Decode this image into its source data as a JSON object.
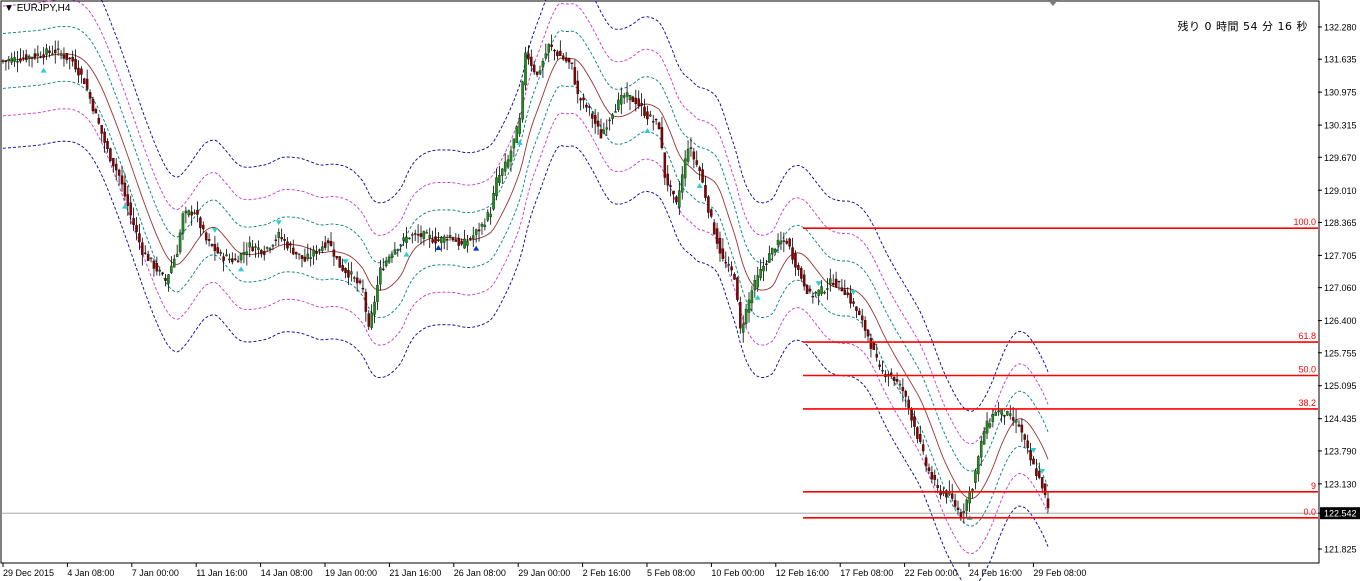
{
  "window": {
    "title_arrow": "▼",
    "title": "EURJPY,H4",
    "countdown": "残り 0 時間 54 分 16 秒"
  },
  "colors": {
    "bull": "#1a8f1a",
    "bear": "#8b0000",
    "wick": "#000000",
    "middle": "#993333",
    "band1": "#008080",
    "band2": "#cc33cc",
    "band3": "#000099",
    "fib": "#ff0000",
    "arrow_cyan": "#33cccc",
    "arrow_blue": "#0033cc",
    "price_tag_bg": "#000000"
  },
  "chart_data": {
    "type": "candlestick",
    "symbol": "EURJPY",
    "timeframe": "H4",
    "ylim": [
      121.825,
      132.6
    ],
    "y_ticks": [
      "132.280",
      "131.635",
      "130.975",
      "130.315",
      "129.670",
      "129.010",
      "128.365",
      "127.705",
      "127.060",
      "126.400",
      "125.755",
      "125.095",
      "124.435",
      "123.790",
      "123.130",
      "122.542",
      "121.825"
    ],
    "x_ticks": [
      "29 Dec 2015",
      "4 Jan 08:00",
      "7 Jan 00:00",
      "11 Jan 16:00",
      "14 Jan 08:00",
      "19 Jan 00:00",
      "21 Jan 16:00",
      "26 Jan 08:00",
      "29 Jan 00:00",
      "2 Feb 16:00",
      "5 Feb 08:00",
      "10 Feb 00:00",
      "12 Feb 16:00",
      "17 Feb 08:00",
      "22 Feb 00:00",
      "24 Feb 16:00",
      "29 Feb 08:00"
    ],
    "current_price": "122.542",
    "close_path": [
      [
        0,
        131.6
      ],
      [
        10,
        131.7
      ],
      [
        18,
        131.8
      ],
      [
        24,
        131.6
      ],
      [
        28,
        131.2
      ],
      [
        32,
        130.5
      ],
      [
        36,
        129.8
      ],
      [
        40,
        129.3
      ],
      [
        44,
        128.5
      ],
      [
        48,
        127.8
      ],
      [
        52,
        127.5
      ],
      [
        56,
        127.2
      ],
      [
        60,
        127.8
      ],
      [
        62,
        128.5
      ],
      [
        66,
        128.6
      ],
      [
        70,
        128.0
      ],
      [
        75,
        127.7
      ],
      [
        80,
        127.6
      ],
      [
        85,
        127.9
      ],
      [
        90,
        127.8
      ],
      [
        95,
        128.1
      ],
      [
        100,
        127.8
      ],
      [
        104,
        127.6
      ],
      [
        108,
        127.8
      ],
      [
        112,
        128.0
      ],
      [
        116,
        127.5
      ],
      [
        120,
        127.3
      ],
      [
        124,
        127.0
      ],
      [
        126,
        126.2
      ],
      [
        130,
        127.4
      ],
      [
        134,
        127.8
      ],
      [
        140,
        128.1
      ],
      [
        145,
        128.1
      ],
      [
        150,
        128.0
      ],
      [
        154,
        128.1
      ],
      [
        158,
        127.9
      ],
      [
        162,
        128.1
      ],
      [
        165,
        128.3
      ],
      [
        168,
        128.6
      ],
      [
        170,
        129.2
      ],
      [
        174,
        129.6
      ],
      [
        178,
        130.4
      ],
      [
        180,
        131.8
      ],
      [
        184,
        131.3
      ],
      [
        188,
        131.9
      ],
      [
        192,
        131.7
      ],
      [
        196,
        131.5
      ],
      [
        198,
        130.9
      ],
      [
        202,
        130.6
      ],
      [
        206,
        130.1
      ],
      [
        210,
        130.6
      ],
      [
        214,
        130.9
      ],
      [
        218,
        130.8
      ],
      [
        222,
        130.5
      ],
      [
        226,
        130.3
      ],
      [
        228,
        129.3
      ],
      [
        232,
        128.7
      ],
      [
        236,
        129.9
      ],
      [
        240,
        129.4
      ],
      [
        244,
        128.4
      ],
      [
        248,
        127.6
      ],
      [
        252,
        127.3
      ],
      [
        254,
        126.2
      ],
      [
        258,
        127.0
      ],
      [
        262,
        127.5
      ],
      [
        266,
        127.9
      ],
      [
        270,
        128.0
      ],
      [
        274,
        127.4
      ],
      [
        278,
        126.9
      ],
      [
        282,
        127.0
      ],
      [
        286,
        127.2
      ],
      [
        290,
        127.0
      ],
      [
        294,
        126.6
      ],
      [
        298,
        126.1
      ],
      [
        302,
        125.4
      ],
      [
        306,
        125.3
      ],
      [
        310,
        125.0
      ],
      [
        314,
        124.3
      ],
      [
        318,
        123.5
      ],
      [
        322,
        123.0
      ],
      [
        326,
        122.9
      ],
      [
        330,
        122.5
      ],
      [
        334,
        123.1
      ],
      [
        338,
        124.2
      ],
      [
        342,
        124.6
      ],
      [
        346,
        124.5
      ],
      [
        350,
        124.3
      ],
      [
        354,
        123.6
      ],
      [
        358,
        123.1
      ],
      [
        360,
        122.6
      ]
    ],
    "fibonacci": [
      {
        "label": "100.0",
        "price": 128.25
      },
      {
        "label": "61.8",
        "price": 125.97
      },
      {
        "label": "50.0",
        "price": 125.3
      },
      {
        "label": "38.2",
        "price": 124.63
      },
      {
        "label": "9",
        "price": 122.97
      },
      {
        "label": "0.0",
        "price": 122.45
      }
    ]
  }
}
